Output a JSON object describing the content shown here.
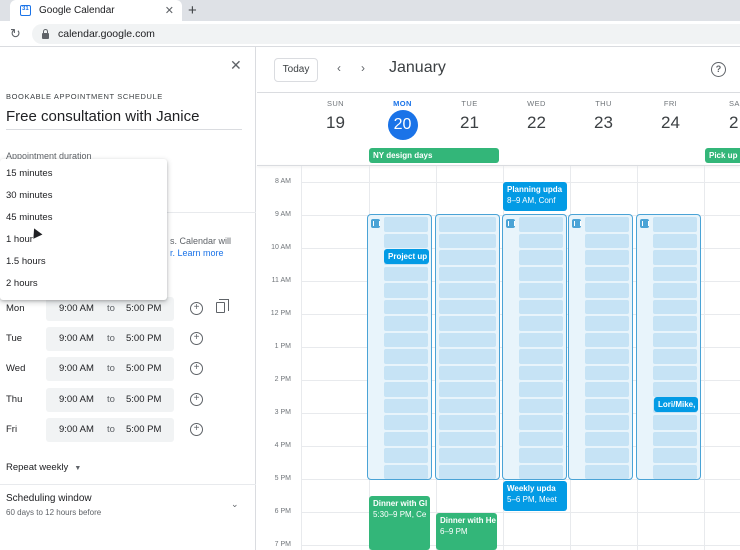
{
  "browser": {
    "tab_title": "Google Calendar",
    "tab_close": "✕",
    "new_tab": "+",
    "reload": "↻",
    "url": "calendar.google.com"
  },
  "panel": {
    "close": "✕",
    "eyebrow": "BOOKABLE APPOINTMENT SCHEDULE",
    "title": "Free consultation with Janice",
    "hidden_label": "Appointment duration",
    "hidden_desc_1": "s. Calendar will",
    "hidden_desc_2": "r. Learn more",
    "duration_options": [
      "15 minutes",
      "30 minutes",
      "45 minutes",
      "1 hour",
      "1.5 hours",
      "2 hours"
    ],
    "availability": [
      {
        "day": "Mon",
        "start": "9:00 AM",
        "to": "to",
        "end": "5:00 PM"
      },
      {
        "day": "Tue",
        "start": "9:00 AM",
        "to": "to",
        "end": "5:00 PM"
      },
      {
        "day": "Wed",
        "start": "9:00 AM",
        "to": "to",
        "end": "5:00 PM"
      },
      {
        "day": "Thu",
        "start": "9:00 AM",
        "to": "to",
        "end": "5:00 PM"
      },
      {
        "day": "Fri",
        "start": "9:00 AM",
        "to": "to",
        "end": "5:00 PM"
      }
    ],
    "repeat": "Repeat weekly",
    "scheduling_title": "Scheduling window",
    "scheduling_sub": "60 days to 12 hours before"
  },
  "calendar": {
    "today_button": "Today",
    "prev": "‹",
    "next": "›",
    "month": "January",
    "help": "?",
    "days": [
      {
        "name": "SUN",
        "num": "19"
      },
      {
        "name": "MON",
        "num": "20"
      },
      {
        "name": "TUE",
        "num": "21"
      },
      {
        "name": "WED",
        "num": "22"
      },
      {
        "name": "THU",
        "num": "23"
      },
      {
        "name": "FRI",
        "num": "24"
      },
      {
        "name": "SA",
        "num": "2"
      }
    ],
    "allday_events": [
      "NY design days",
      "Pick up"
    ],
    "hours": [
      "8 AM",
      "9 AM",
      "10 AM",
      "11 AM",
      "12 PM",
      "1 PM",
      "2 PM",
      "3 PM",
      "4 PM",
      "5 PM",
      "6 PM",
      "7 PM"
    ],
    "events": {
      "planning_title": "Planning upda",
      "planning_time": "8–9 AM, Conf",
      "project_title": "Project up",
      "lori_title": "Lori/Mike,",
      "weekly_title": "Weekly upda",
      "weekly_time": "5–6 PM, Meet",
      "dinner1_title": "Dinner with Gl",
      "dinner1_time": "5:30–9 PM, Ce",
      "dinner2_title": "Dinner with He",
      "dinner2_time": "6–9 PM"
    },
    "colors": {
      "accent": "#1a73e8",
      "event_blue": "#039be5",
      "event_green": "#33b679",
      "schedule_block": "#4aa3d6"
    }
  }
}
